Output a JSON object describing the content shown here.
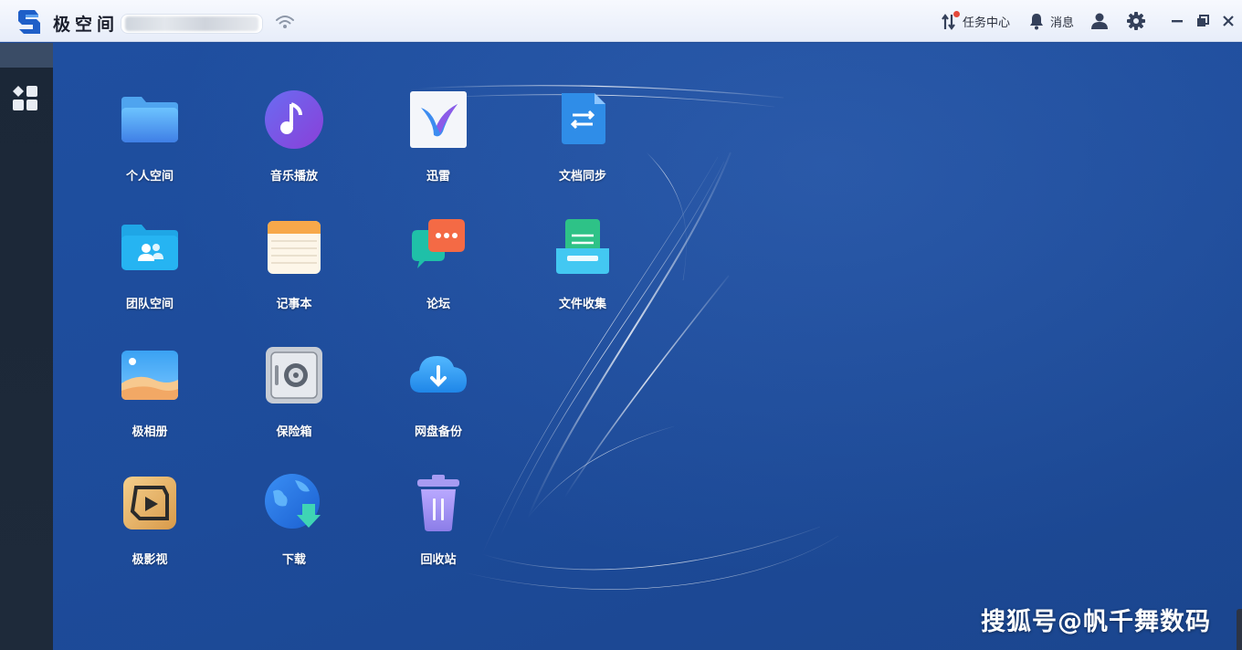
{
  "titlebar": {
    "app_name": "极空间",
    "task_center": "任务中心",
    "messages": "消息"
  },
  "apps": [
    {
      "label": "个人空间",
      "icon": "personal-folder-icon"
    },
    {
      "label": "音乐播放",
      "icon": "music-player-icon"
    },
    {
      "label": "迅雷",
      "icon": "thunder-bird-icon"
    },
    {
      "label": "文档同步",
      "icon": "document-sync-icon"
    },
    {
      "label": "团队空间",
      "icon": "team-folder-icon"
    },
    {
      "label": "记事本",
      "icon": "notepad-icon"
    },
    {
      "label": "论坛",
      "icon": "forum-chat-icon"
    },
    {
      "label": "文件收集",
      "icon": "file-collection-icon"
    },
    {
      "label": "极相册",
      "icon": "photo-album-icon"
    },
    {
      "label": "保险箱",
      "icon": "safe-box-icon"
    },
    {
      "label": "网盘备份",
      "icon": "cloud-backup-icon"
    },
    {
      "label": "极影视",
      "icon": "video-player-icon"
    },
    {
      "label": "下载",
      "icon": "download-globe-icon"
    },
    {
      "label": "回收站",
      "icon": "recycle-bin-icon"
    }
  ],
  "watermark": "搜狐号@帆千舞数码",
  "colors": {
    "desktop": "#1e4b97",
    "titlebar": "#eef2fb",
    "sidebar": "#1c2838",
    "notification_dot": "#e5493a"
  }
}
